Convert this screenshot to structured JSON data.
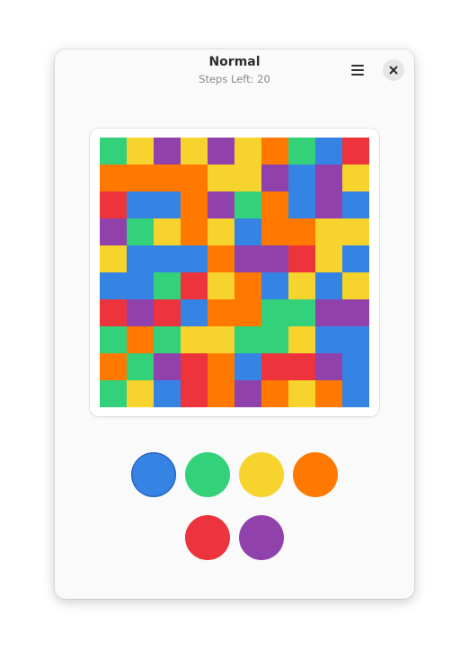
{
  "window": {
    "title": "Normal",
    "subtitle": "Steps Left: 20"
  },
  "palette": {
    "blue": "#3584e4",
    "green": "#33d17a",
    "yellow": "#f6d32d",
    "orange": "#ff7800",
    "red": "#ed333b",
    "purple": "#9141ac"
  },
  "board": [
    [
      "green",
      "yellow",
      "purple",
      "yellow",
      "purple",
      "yellow",
      "orange",
      "green",
      "blue",
      "red"
    ],
    [
      "orange",
      "orange",
      "orange",
      "orange",
      "yellow",
      "yellow",
      "purple",
      "blue",
      "purple",
      "yellow"
    ],
    [
      "red",
      "blue",
      "blue",
      "orange",
      "purple",
      "green",
      "orange",
      "blue",
      "purple",
      "blue"
    ],
    [
      "purple",
      "green",
      "yellow",
      "orange",
      "yellow",
      "blue",
      "orange",
      "orange",
      "yellow",
      "yellow"
    ],
    [
      "yellow",
      "blue",
      "blue",
      "blue",
      "orange",
      "purple",
      "purple",
      "red",
      "yellow",
      "blue"
    ],
    [
      "blue",
      "blue",
      "green",
      "red",
      "yellow",
      "orange",
      "blue",
      "yellow",
      "blue",
      "yellow"
    ],
    [
      "red",
      "purple",
      "red",
      "blue",
      "orange",
      "orange",
      "green",
      "green",
      "purple",
      "purple"
    ],
    [
      "green",
      "orange",
      "green",
      "yellow",
      "yellow",
      "green",
      "green",
      "yellow",
      "blue",
      "blue"
    ],
    [
      "orange",
      "green",
      "purple",
      "red",
      "orange",
      "blue",
      "red",
      "red",
      "purple",
      "blue"
    ],
    [
      "green",
      "yellow",
      "blue",
      "red",
      "orange",
      "purple",
      "orange",
      "yellow",
      "orange",
      "blue"
    ]
  ],
  "color_buttons": [
    {
      "color": "blue",
      "selected": true
    },
    {
      "color": "green",
      "selected": false
    },
    {
      "color": "yellow",
      "selected": false
    },
    {
      "color": "orange",
      "selected": false
    },
    {
      "color": "red",
      "selected": false
    },
    {
      "color": "purple",
      "selected": false
    }
  ],
  "icons": {
    "menu": "hamburger-menu-icon",
    "close": "close-icon"
  }
}
